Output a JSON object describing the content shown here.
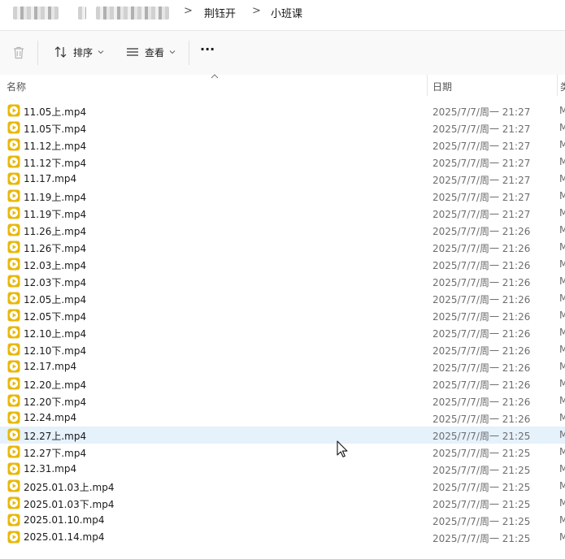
{
  "breadcrumb": {
    "separator": ">",
    "items": [
      "荆钰开",
      "小班课"
    ]
  },
  "toolbar": {
    "sort_label": "排序",
    "view_label": "查看",
    "more_label": "···"
  },
  "columns": {
    "name_header": "名称",
    "date_header": "日期",
    "next_header_fragment": "类"
  },
  "files": [
    {
      "name": "11.05上.mp4",
      "date": "2025/7/7/周一 21:27"
    },
    {
      "name": "11.05下.mp4",
      "date": "2025/7/7/周一 21:27"
    },
    {
      "name": "11.12上.mp4",
      "date": "2025/7/7/周一 21:27"
    },
    {
      "name": "11.12下.mp4",
      "date": "2025/7/7/周一 21:27"
    },
    {
      "name": "11.17.mp4",
      "date": "2025/7/7/周一 21:27"
    },
    {
      "name": "11.19上.mp4",
      "date": "2025/7/7/周一 21:27"
    },
    {
      "name": "11.19下.mp4",
      "date": "2025/7/7/周一 21:27"
    },
    {
      "name": "11.26上.mp4",
      "date": "2025/7/7/周一 21:26"
    },
    {
      "name": "11.26下.mp4",
      "date": "2025/7/7/周一 21:26"
    },
    {
      "name": "12.03上.mp4",
      "date": "2025/7/7/周一 21:26"
    },
    {
      "name": "12.03下.mp4",
      "date": "2025/7/7/周一 21:26"
    },
    {
      "name": "12.05上.mp4",
      "date": "2025/7/7/周一 21:26"
    },
    {
      "name": "12.05下.mp4",
      "date": "2025/7/7/周一 21:26"
    },
    {
      "name": "12.10上.mp4",
      "date": "2025/7/7/周一 21:26"
    },
    {
      "name": "12.10下.mp4",
      "date": "2025/7/7/周一 21:26"
    },
    {
      "name": "12.17.mp4",
      "date": "2025/7/7/周一 21:26"
    },
    {
      "name": "12.20上.mp4",
      "date": "2025/7/7/周一 21:26"
    },
    {
      "name": "12.20下.mp4",
      "date": "2025/7/7/周一 21:26"
    },
    {
      "name": "12.24.mp4",
      "date": "2025/7/7/周一 21:26"
    },
    {
      "name": "12.27上.mp4",
      "date": "2025/7/7/周一 21:25",
      "selected": true
    },
    {
      "name": "12.27下.mp4",
      "date": "2025/7/7/周一 21:25"
    },
    {
      "name": "12.31.mp4",
      "date": "2025/7/7/周一 21:25"
    },
    {
      "name": "2025.01.03上.mp4",
      "date": "2025/7/7/周一 21:25"
    },
    {
      "name": "2025.01.03下.mp4",
      "date": "2025/7/7/周一 21:25"
    },
    {
      "name": "2025.01.10.mp4",
      "date": "2025/7/7/周一 21:25"
    },
    {
      "name": "2025.01.14.mp4",
      "date": "2025/7/7/周一 21:25"
    }
  ],
  "row_truncated_char": "M",
  "icons": {
    "file": "video-file-icon",
    "delete": "trash-icon",
    "sort": "sort-arrows-icon",
    "view": "view-lines-icon",
    "sort_indicator": "chevron-up-icon",
    "pointer": "mouse-cursor-icon"
  },
  "colors": {
    "selected_row": "#e5f1fb",
    "file_icon": "#e8b80c",
    "date_text": "#6e6e6e"
  }
}
